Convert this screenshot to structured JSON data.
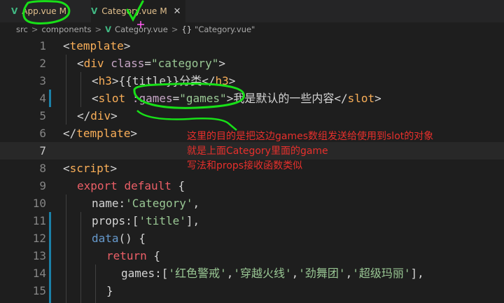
{
  "tabs": [
    {
      "name": "App.vue",
      "badge": "M"
    },
    {
      "name": "Category.vue",
      "badge": "M",
      "close": "✕"
    }
  ],
  "breadcrumb": {
    "src": "src",
    "components": "components",
    "file": "Category.vue",
    "symbol": "\"Category.vue\""
  },
  "icons": {
    "vue": "vue-file-icon",
    "braces": "braces-icon",
    "chevron": "chevron-right-icon"
  },
  "code": {
    "line_numbers": [
      "1",
      "2",
      "3",
      "4",
      "5",
      "6",
      "7",
      "8",
      "9",
      "10",
      "11",
      "12",
      "13",
      "14",
      "15"
    ],
    "l1_tag": "template",
    "l2_tag": "div",
    "l2_attr": "class",
    "l2_val": "\"category\"",
    "l3_tag": "h3",
    "l3_text": "{{title}}分类",
    "l4_tag": "slot",
    "l4_attr": ":games",
    "l4_val": "\"games\"",
    "l4_text": "我是默认的一些内容",
    "l5_tag": "div",
    "l6_tag": "template",
    "l8_tag": "script",
    "l9_export": "export",
    "l9_default": "default",
    "l10_key": "name",
    "l10_val": "'Category'",
    "l11_key": "props",
    "l11_val": "'title'",
    "l12_fn": "data",
    "l13_kw": "return",
    "l14_key": "games",
    "l14_items": [
      "'红色警戒'",
      "'穿越火线'",
      "'劲舞团'",
      "'超级玛丽'"
    ]
  },
  "note": {
    "line1": "这里的目的是把这边games数组发送给使用到slot的对象",
    "line2": "就是上面Category里面的game",
    "line3": "写法和props接收函数类似"
  },
  "colors": {
    "annotation": "#e8302c",
    "pen": "#18e018",
    "cursor": "#ff5cf0",
    "vue": "#41b883"
  }
}
